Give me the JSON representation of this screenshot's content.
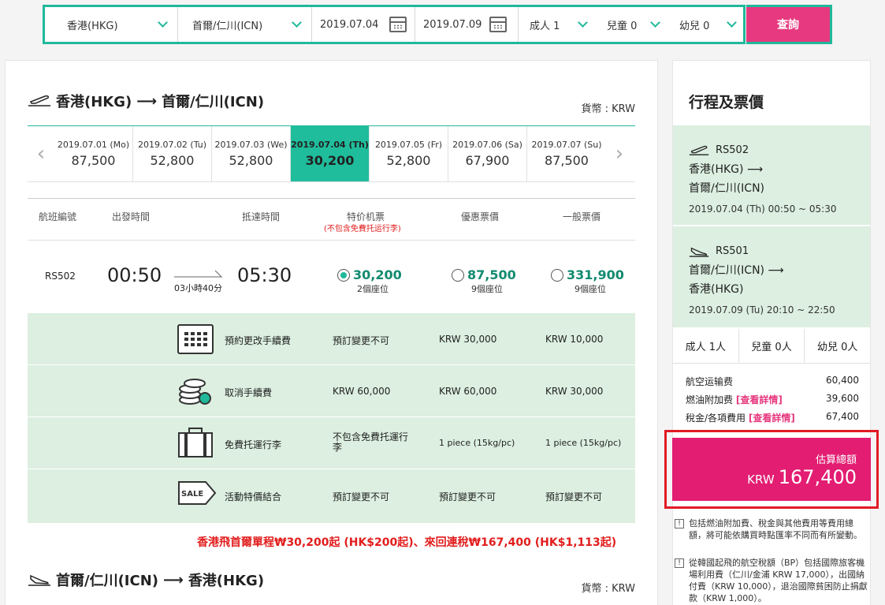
{
  "search": {
    "from": "香港(HKG)",
    "to": "首爾/仁川(ICN)",
    "depart_date": "2019.07.04",
    "return_date": "2019.07.09",
    "adults": "成人 1",
    "children": "兒童 0",
    "infants": "幼兒 0",
    "button": "查詢"
  },
  "outbound": {
    "route_from": "香港(HKG)",
    "route_to": "首爾/仁川(ICN)",
    "currency": "貨幣 : KRW",
    "dates": [
      {
        "date": "2019.07.01 (Mo)",
        "price": "87,500"
      },
      {
        "date": "2019.07.02 (Tu)",
        "price": "52,800"
      },
      {
        "date": "2019.07.03 (We)",
        "price": "52,800"
      },
      {
        "date": "2019.07.04 (Th)",
        "price": "30,200"
      },
      {
        "date": "2019.07.05 (Fr)",
        "price": "52,800"
      },
      {
        "date": "2019.07.06 (Sa)",
        "price": "67,900"
      },
      {
        "date": "2019.07.07 (Su)",
        "price": "87,500"
      }
    ],
    "columns": {
      "flight_no": "航班編號",
      "dep_time": "出發時間",
      "arr_time": "抵達時間",
      "special": "特价机票",
      "special_note": "(不包含免費托运行李)",
      "discount": "優惠票價",
      "normal": "一般票價"
    },
    "flight": {
      "number": "RS502",
      "dep": "00:50",
      "duration": "03小時40分",
      "arr": "05:30",
      "special_price": "30,200",
      "special_seats": "2個座位",
      "discount_price": "87,500",
      "discount_seats": "9個座位",
      "normal_price": "331,900",
      "normal_seats": "9個座位"
    },
    "rules": [
      {
        "icon": "calendar-icon",
        "name": "預約更改手續費",
        "special": "預訂變更不可",
        "discount": "KRW 30,000",
        "normal": "KRW 10,000"
      },
      {
        "icon": "coins-icon",
        "name": "取消手續費",
        "special": "KRW 60,000",
        "discount": "KRW 60,000",
        "normal": "KRW 30,000"
      },
      {
        "icon": "luggage-icon",
        "name": "免費托運行李",
        "special": "不包含免費托運行李",
        "discount": "1 piece (15kg/pc)",
        "normal": "1 piece (15kg/pc)"
      },
      {
        "icon": "sale-tag-icon",
        "name": "活動特價結合",
        "special": "預訂變更不可",
        "discount": "預訂變更不可",
        "normal": "預訂變更不可"
      }
    ],
    "sale_label": "SALE"
  },
  "promo": "香港飛首爾單程₩30,200起 (HK$200起)、來回連稅₩167,400 (HK$1,113起)",
  "return_route": {
    "route_from": "首爾/仁川(ICN)",
    "route_to": "香港(HKG)",
    "currency": "貨幣 : KRW"
  },
  "summary": {
    "title": "行程及票價",
    "leg1": {
      "flight": "RS502",
      "from": "香港(HKG)",
      "to": "首爾/仁川(ICN)",
      "when": "2019.07.04 (Th) 00:50 ~ 05:30"
    },
    "leg2": {
      "flight": "RS501",
      "from": "首爾/仁川(ICN)",
      "to": "香港(HKG)",
      "when": "2019.07.09 (Tu) 20:10 ~ 22:50"
    },
    "pax": {
      "adult": "成人 1人",
      "child": "兒童 0人",
      "infant": "幼兒 0人"
    },
    "fees": [
      {
        "label": "航空运输费",
        "link": "",
        "value": "60,400"
      },
      {
        "label": "燃油附加费",
        "link": "[查看詳情]",
        "value": "39,600"
      },
      {
        "label": "稅金/各項費用",
        "link": "[查看詳情]",
        "value": "67,400"
      }
    ],
    "total_label": "估算總額",
    "total_currency": "KRW",
    "total_amount": "167,400",
    "note1": "包括燃油附加費、稅金與其他費用等費用總額，將可能依購買時點匯率不同而有所變動。",
    "note2": "從韓國起飛的航空稅額（BP）包括國際旅客機場利用費（仁川/金浦 KRW 17,000），出國納付費（KRW 10,000），退治國際貧困防止捐獻款（KRW 1,000）。"
  }
}
